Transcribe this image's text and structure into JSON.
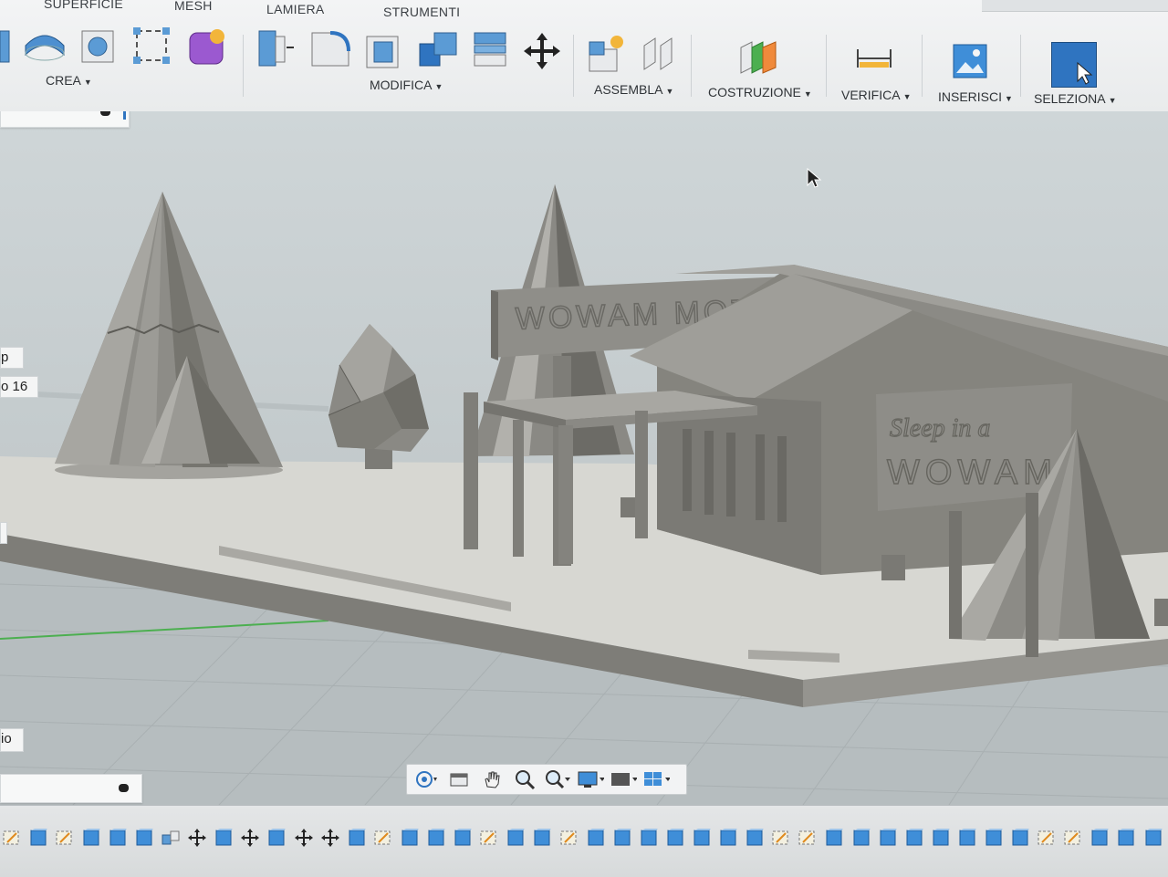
{
  "workspace_tabs": [
    "SUPERFICIE",
    "MESH",
    "LAMIERA",
    "STRUMENTI"
  ],
  "toolbar_groups": {
    "crea": "CREA",
    "modifica": "MODIFICA",
    "assembla": "ASSEMBLA",
    "costruzione": "COSTRUZIONE",
    "verifica": "VERIFICA",
    "inserisci": "INSERISCI",
    "seleziona": "SELEZIONA"
  },
  "icons": {
    "crea": [
      "extrude-icon",
      "revolve-icon",
      "sweep-icon",
      "sketch-rectangle-icon",
      "form-icon"
    ],
    "modifica": [
      "press-pull-icon",
      "fillet-icon",
      "shell-icon",
      "combine-icon",
      "align-icon",
      "move-icon"
    ],
    "assembla": [
      "new-component-icon",
      "joint-icon"
    ],
    "costruzione": [
      "offset-plane-icon"
    ],
    "verifica": [
      "measure-icon"
    ],
    "inserisci": [
      "insert-image-icon"
    ],
    "seleziona": [
      "select-cursor-icon"
    ]
  },
  "side_labels": {
    "label_p": "p",
    "label_16": "o 16",
    "label_io": "io"
  },
  "model_text": {
    "sign_main": "WOWAM MOTEL",
    "sign_sleep": "Sleep in a",
    "sign_wowam": "WOWAM"
  },
  "navbar_icons": [
    "orbit-icon",
    "look-at-icon",
    "pan-icon",
    "zoom-icon",
    "fit-icon",
    "display-settings-icon",
    "grid-settings-icon",
    "viewports-icon"
  ],
  "timeline_count": 44,
  "colors": {
    "accent": "#2f74c0",
    "model_gray": "#8b8a85",
    "ribbon_bg": "#eceeef",
    "viewport_bg": "#c6cdcf"
  }
}
